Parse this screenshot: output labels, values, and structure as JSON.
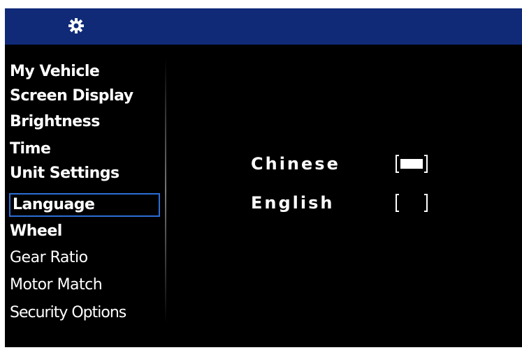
{
  "header": {
    "icon": "gear-icon"
  },
  "sidebar": {
    "items": [
      {
        "label": "My Vehicle",
        "selected": false
      },
      {
        "label": "Screen Display",
        "selected": false
      },
      {
        "label": "Brightness",
        "selected": false
      },
      {
        "label": "Time",
        "selected": false
      },
      {
        "label": "Unit Settings",
        "selected": false
      },
      {
        "label": "Language",
        "selected": true
      },
      {
        "label": "Wheel",
        "selected": false
      },
      {
        "label": "Gear Ratio",
        "selected": false
      },
      {
        "label": "Motor Match",
        "selected": false
      },
      {
        "label": "Security Options",
        "selected": false
      }
    ]
  },
  "language": {
    "options": [
      {
        "label": "Chinese",
        "checked": true
      },
      {
        "label": "English",
        "checked": false
      }
    ]
  },
  "colors": {
    "header_bg": "#102a78",
    "screen_bg": "#000000",
    "selection_border": "#2b6fd6",
    "text": "#ffffff"
  }
}
